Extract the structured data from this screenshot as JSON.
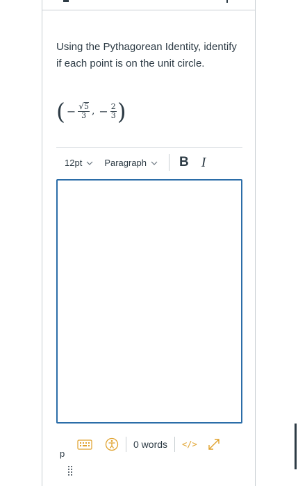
{
  "question": {
    "prompt": "Using the Pythagorean Identity, identify if each point is on the unit circle.",
    "point": {
      "x_sign": "−",
      "x_numerator_radicand": "5",
      "x_denominator": "3",
      "y_sign": "−",
      "y_numerator": "2",
      "y_denominator": "3"
    }
  },
  "toolbar": {
    "font_size": "12pt",
    "block_format": "Paragraph",
    "bold_label": "B",
    "italic_label": "I"
  },
  "editor": {
    "content": ""
  },
  "status_bar": {
    "path": "p",
    "word_count": "0 words",
    "html_toggle": "</>"
  },
  "colors": {
    "text": "#2d3b45",
    "editor_border": "#2b6da8",
    "icon_accent": "#e0a12b"
  }
}
